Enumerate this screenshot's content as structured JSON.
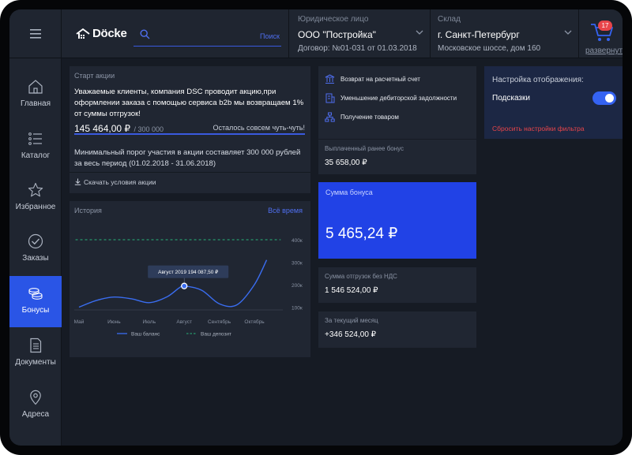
{
  "header": {
    "logo_text": "Döcke",
    "search": {
      "placeholder": "",
      "button_label": "Поиск"
    },
    "entity": {
      "label": "Юридическое лицо",
      "value": "ООО \"Постройка\"",
      "contract": "Договор: №01-031 от 01.03.2018"
    },
    "warehouse": {
      "label": "Склад",
      "value": "г. Санкт-Петербург",
      "address": "Московское шоссе, дом 160"
    },
    "cart": {
      "count": "17",
      "expand_label": "развернуть"
    }
  },
  "sidebar": {
    "items": [
      {
        "label": "Главная",
        "icon": "home-icon"
      },
      {
        "label": "Каталог",
        "icon": "list-icon"
      },
      {
        "label": "Избранное",
        "icon": "star-icon"
      },
      {
        "label": "Заказы",
        "icon": "check-icon"
      },
      {
        "label": "Бонусы",
        "icon": "coins-icon",
        "active": true
      },
      {
        "label": "Документы",
        "icon": "document-icon"
      },
      {
        "label": "Адреса",
        "icon": "pin-icon"
      }
    ]
  },
  "promo": {
    "title": "Старт акции",
    "text": "Уважаемые клиенты, компания DSC проводит акцию,при оформлении заказа с помощью сервиса b2b мы возвращаем 1% от суммы отгрузок!",
    "current": "145 464,00 ₽",
    "total": "/ 300 000",
    "remaining": "Осталось совсем чуть-чуть!",
    "progress_fraction": 0.485,
    "terms": "Минимальный порог участия в акции составляет 300 000 рублей за весь период (01.02.2018 - 31.06.2018)",
    "download_label": "Скачать условия акции"
  },
  "history": {
    "title": "История",
    "period_label": "Всё время",
    "tooltip": "Август 2019  194 087,50 ₽"
  },
  "chart_data": {
    "type": "line",
    "x": [
      "Май",
      "Июнь",
      "Июль",
      "Август",
      "Сентябрь",
      "Октябрь"
    ],
    "y_ticks": [
      "100к",
      "200к",
      "300к",
      "400к"
    ],
    "ylim": [
      100000,
      400000
    ],
    "series": [
      {
        "name": "Ваш баланс",
        "style": "solid",
        "color": "#3a6df0",
        "points": [
          {
            "x": 0,
            "y": 100000
          },
          {
            "x": 0.5,
            "y": 130000
          },
          {
            "x": 1,
            "y": 145000
          },
          {
            "x": 1.5,
            "y": 137000
          },
          {
            "x": 2,
            "y": 120000
          },
          {
            "x": 2.5,
            "y": 145000
          },
          {
            "x": 2.85,
            "y": 185000
          },
          {
            "x": 3,
            "y": 194087.5
          },
          {
            "x": 3.5,
            "y": 175000
          },
          {
            "x": 4,
            "y": 115000
          },
          {
            "x": 4.5,
            "y": 110000
          },
          {
            "x": 5,
            "y": 200000
          },
          {
            "x": 5.35,
            "y": 310000
          }
        ]
      },
      {
        "name": "Ваш депозит",
        "style": "dashed",
        "color": "#27b47a",
        "points": [
          {
            "x": -0.1,
            "y": 400000
          },
          {
            "x": 5.75,
            "y": 400000
          }
        ]
      }
    ],
    "highlight": {
      "x": 3,
      "y": 194087.5
    }
  },
  "actions": [
    {
      "label": "Возврат на расчетный счет",
      "icon": "bank-icon"
    },
    {
      "label": "Уменьшение дебиторской задолжности",
      "icon": "building-icon"
    },
    {
      "label": "Получение товаром",
      "icon": "network-icon"
    }
  ],
  "stats": {
    "paid_label": "Выплаченный ранее бонус",
    "paid_value": "35 658,00 ₽",
    "bonus_label": "Сумма бонуса",
    "bonus_value": "5 465,24 ₽",
    "shipments_label": "Сумма отгрузок без НДС",
    "shipments_value": "1 546 524,00 ₽",
    "month_label": "За текущий месяц",
    "month_value": "+346 524,00 ₽"
  },
  "settings": {
    "title": "Настройка отображения:",
    "hints_label": "Подсказки",
    "hints_on": true,
    "reset_label": "Сбросить настройки фильтра"
  },
  "colors": {
    "accent": "#2a55e6",
    "danger": "#e8454a",
    "deposit": "#27b47a"
  }
}
